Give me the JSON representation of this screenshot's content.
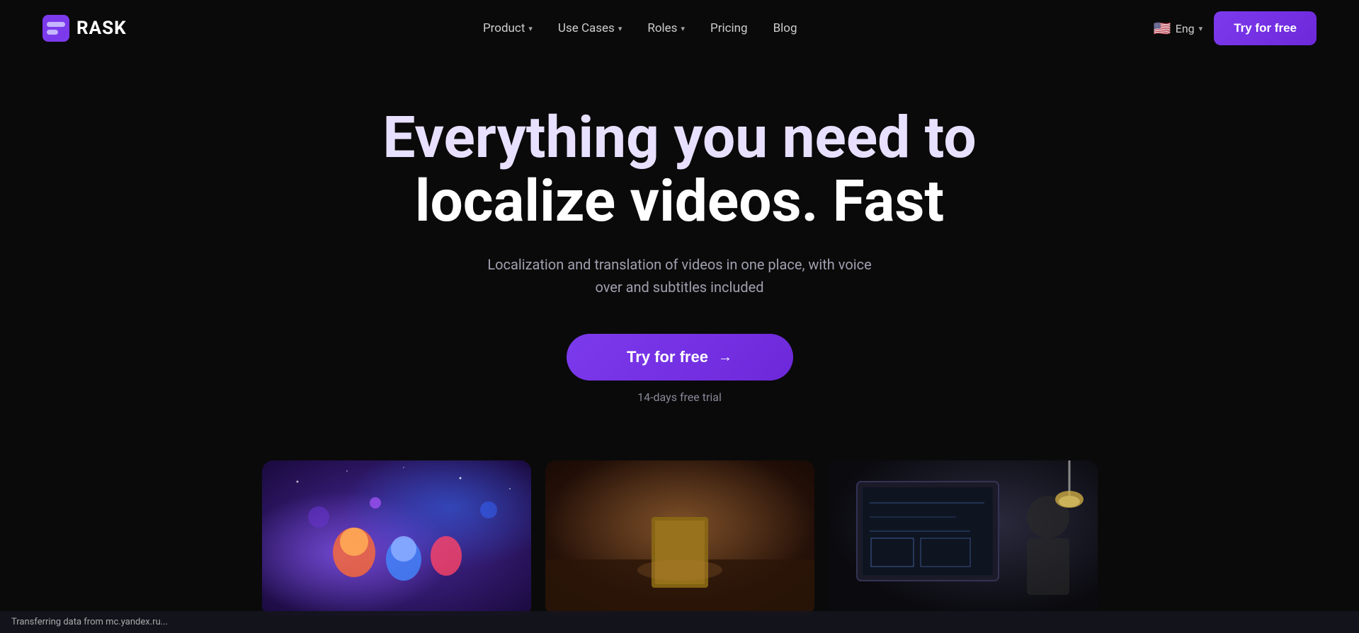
{
  "logo": {
    "text": "RASK"
  },
  "nav": {
    "links": [
      {
        "id": "product",
        "label": "Product",
        "has_dropdown": true
      },
      {
        "id": "use-cases",
        "label": "Use Cases",
        "has_dropdown": true
      },
      {
        "id": "roles",
        "label": "Roles",
        "has_dropdown": true
      },
      {
        "id": "pricing",
        "label": "Pricing",
        "has_dropdown": false
      },
      {
        "id": "blog",
        "label": "Blog",
        "has_dropdown": false
      }
    ],
    "language": {
      "code": "Eng",
      "flag": "🇺🇸"
    },
    "cta": "Try for free"
  },
  "hero": {
    "title_line1": "Everything you need to",
    "title_line2": "localize videos. Fast",
    "subtitle": "Localization and translation of videos in one place, with voice over and subtitles included",
    "cta_button": "Try for free",
    "trial_note": "14-days free trial"
  },
  "thumbnails": [
    {
      "id": "thumb-1",
      "alt": "Animated video localization example"
    },
    {
      "id": "thumb-2",
      "alt": "Video localization example 2"
    },
    {
      "id": "thumb-3",
      "alt": "Screen recording localization example"
    }
  ],
  "status_bar": {
    "text": "Transferring data from mc.yandex.ru..."
  },
  "colors": {
    "accent": "#7c3aed",
    "accent_dark": "#6d28d9",
    "background": "#0a0a0a",
    "text_primary": "#ffffff",
    "text_secondary": "#a0a0b0",
    "hero_title": "#e8e0ff"
  }
}
